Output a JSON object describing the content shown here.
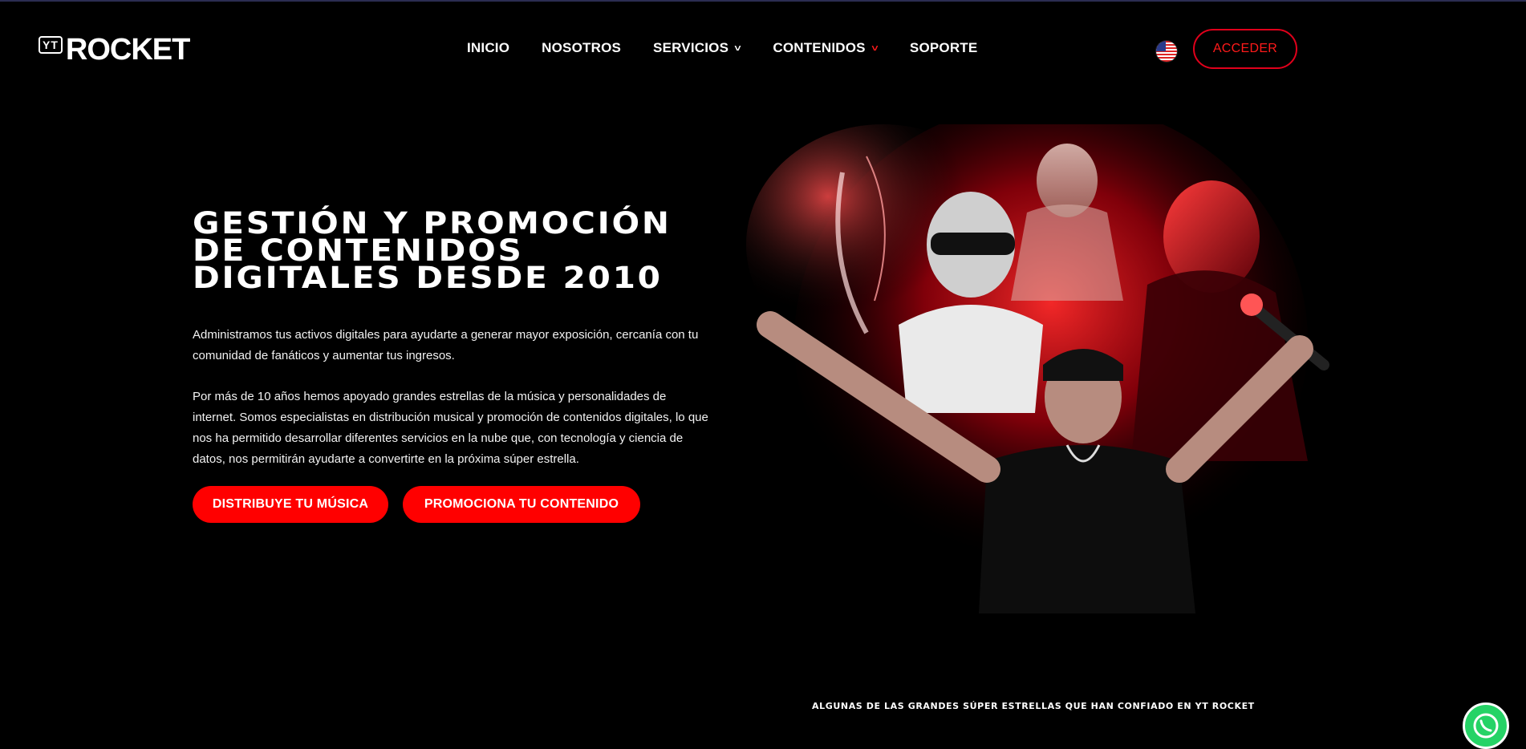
{
  "brand": {
    "logo_badge": "YT",
    "logo_word": "ROCKET"
  },
  "nav": {
    "items": [
      {
        "label": "INICIO"
      },
      {
        "label": "NOSOTROS"
      },
      {
        "label": "SERVICIOS"
      },
      {
        "label": "CONTENIDOS"
      },
      {
        "label": "SOPORTE"
      }
    ]
  },
  "header": {
    "language_flag": "us-flag-icon",
    "login_label": "ACCEDER"
  },
  "hero": {
    "title_lines": [
      "GESTIÓN Y PROMOCIÓN",
      "DE CONTENIDOS",
      "DIGITALES DESDE 2010"
    ],
    "paragraph_1": "Administramos tus activos digitales para ayudarte a generar mayor exposición, cercanía con tu comunidad de fanáticos y aumentar tus ingresos.",
    "paragraph_2": "Por más de 10 años hemos apoyado grandes estrellas de la música y personalidades de internet. Somos especialistas en distribución musical y promoción de contenidos digitales, lo que nos ha permitido desarrollar diferentes servicios en la nube que, con tecnología y ciencia de datos, nos permitirán ayudarte a convertirte en la próxima súper estrella.",
    "cta_primary": "DISTRIBUYE TU MÚSICA",
    "cta_secondary": "PROMOCIONA TU CONTENIDO"
  },
  "partners_label": "ALGUNAS DE LAS GRANDES SÚPER ESTRELLAS QUE HAN CONFIADO EN YT ROCKET",
  "colors": {
    "accent": "#ff0000",
    "background": "#000000",
    "text": "#ffffff",
    "whatsapp": "#25d366"
  }
}
